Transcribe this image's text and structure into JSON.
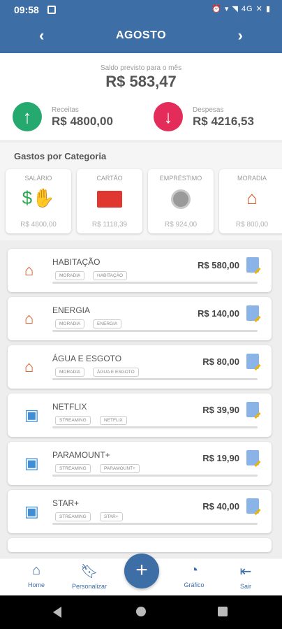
{
  "status_bar": {
    "time": "09:58",
    "right_icons": "⏰ ▾ ◥ 4G ✕ ▮"
  },
  "header": {
    "title": "AGOSTO",
    "prev": "‹",
    "next": "›"
  },
  "summary": {
    "label": "Saldo previsto para o mês",
    "balance": "R$ 583,47",
    "income_label": "Receitas",
    "income_value": "R$ 4800,00",
    "expense_label": "Despesas",
    "expense_value": "R$ 4216,53"
  },
  "categories": {
    "heading": "Gastos por Categoria",
    "items": [
      {
        "name": "SALÁRIO",
        "value": "R$ 4800,00",
        "icon": "money-hand-icon"
      },
      {
        "name": "CARTÃO",
        "value": "R$ 1118,39",
        "icon": "credit-card-icon"
      },
      {
        "name": "EMPRÉSTIMO",
        "value": "R$ 924,00",
        "icon": "coins-icon"
      },
      {
        "name": "MORADIA",
        "value": "R$ 800,00",
        "icon": "house-icon"
      }
    ]
  },
  "transactions": [
    {
      "title": "HABITAÇÃO",
      "amount": "R$ 580,00",
      "tags": [
        "MORADIA",
        "HABITAÇÃO"
      ],
      "icon": "house-icon"
    },
    {
      "title": "ENERGIA",
      "amount": "R$ 140,00",
      "tags": [
        "MORADIA",
        "ENERGIA"
      ],
      "icon": "house-icon"
    },
    {
      "title": "ÁGUA E ESGOTO",
      "amount": "R$ 80,00",
      "tags": [
        "MORADIA",
        "ÁGUA E ESGOTO"
      ],
      "icon": "house-icon"
    },
    {
      "title": "NETFLIX",
      "amount": "R$ 39,90",
      "tags": [
        "STREAMING",
        "NETFLIX"
      ],
      "icon": "laptop-icon"
    },
    {
      "title": "PARAMOUNT+",
      "amount": "R$ 19,90",
      "tags": [
        "STREAMING",
        "PARAMOUNT+"
      ],
      "icon": "laptop-icon"
    },
    {
      "title": "STAR+",
      "amount": "R$ 40,00",
      "tags": [
        "STREAMING",
        "STAR+"
      ],
      "icon": "laptop-icon"
    }
  ],
  "bottom_nav": {
    "home": "Home",
    "personalizar": "Personalizar",
    "grafico": "Gráfico",
    "sair": "Sair",
    "fab": "+"
  },
  "colors": {
    "primary": "#3e6ea6",
    "income": "#26a96e",
    "expense": "#e32c5a"
  }
}
